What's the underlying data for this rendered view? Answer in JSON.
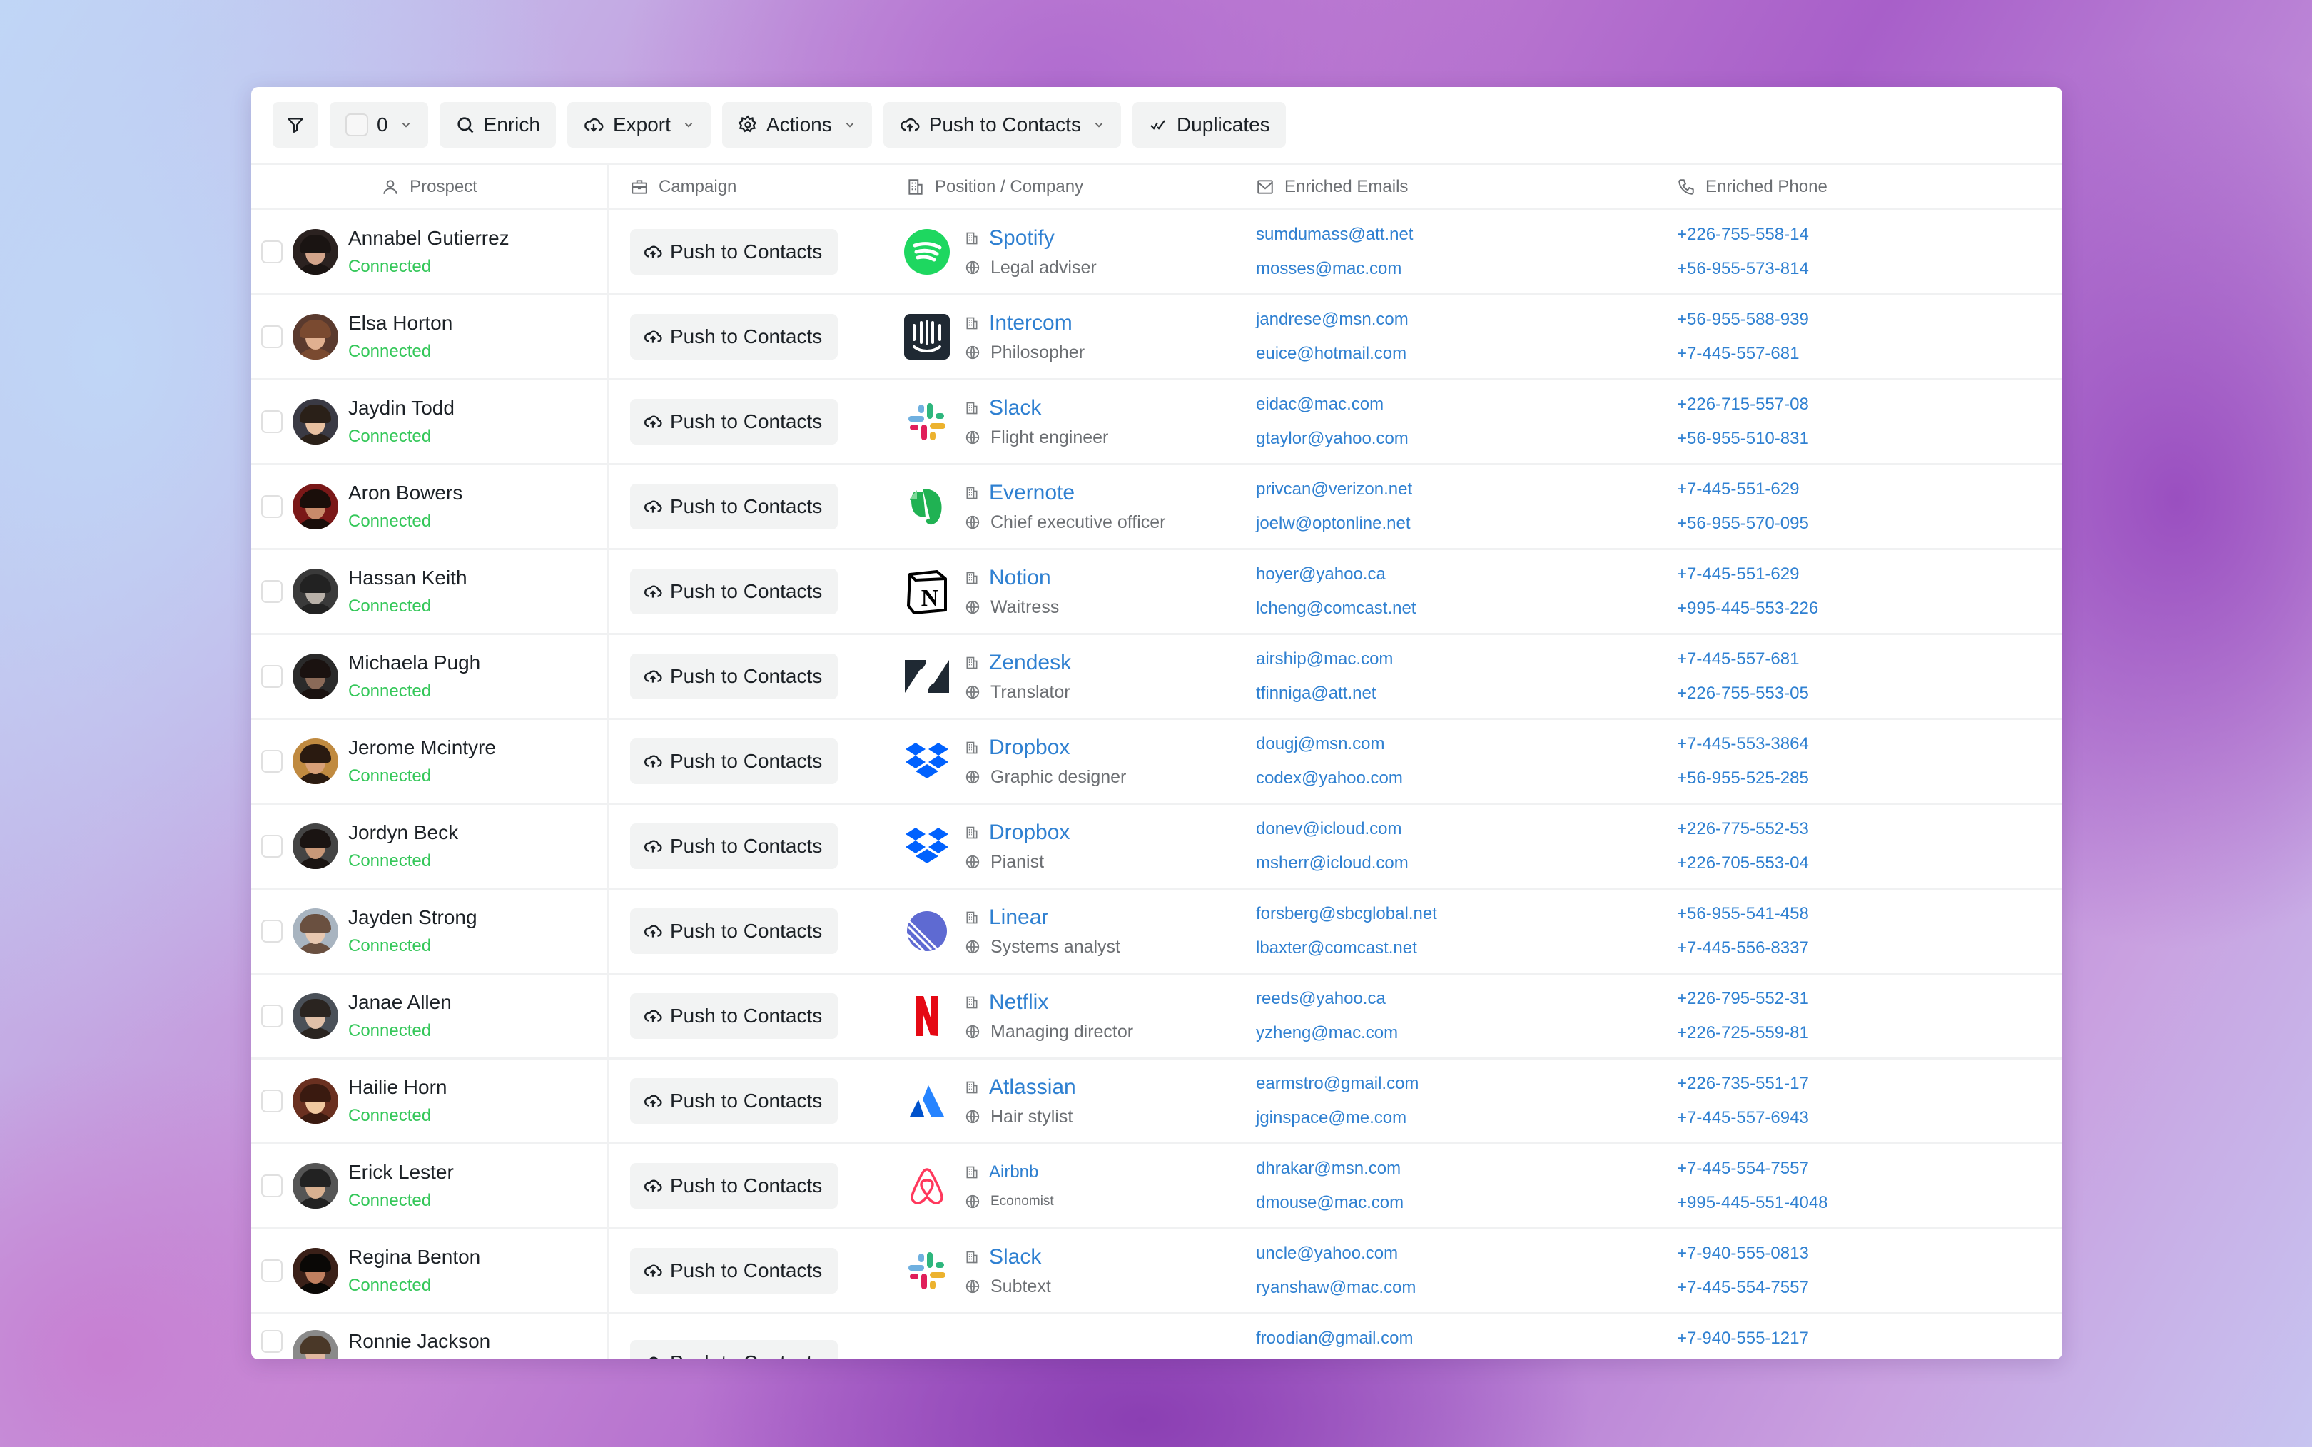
{
  "toolbar": {
    "filter_icon": "filter-icon",
    "selected_count": "0",
    "enrich_label": "Enrich",
    "export_label": "Export",
    "actions_label": "Actions",
    "push_label": "Push to Contacts",
    "duplicates_label": "Duplicates"
  },
  "columns": {
    "prospect": "Prospect",
    "campaign": "Campaign",
    "company": "Position / Company",
    "emails": "Enriched Emails",
    "phone": "Enriched Phone"
  },
  "colors": {
    "accent_link": "#2f80d1",
    "status_connected": "#34c759",
    "button_bg": "#f2f3f3"
  },
  "push_button_label": "Push to Contacts",
  "rows": [
    {
      "name": "Annabel Gutierrez",
      "status": "Connected",
      "company": "Spotify",
      "logo": "spotify",
      "position": "Legal adviser",
      "emails": [
        "sumdumass@att.net",
        "mosses@mac.com"
      ],
      "phones": [
        "+226-755-558-14",
        "+56-955-573-814"
      ]
    },
    {
      "name": "Elsa Horton",
      "status": "Connected",
      "company": "Intercom",
      "logo": "intercom",
      "position": "Philosopher",
      "emails": [
        "jandrese@msn.com",
        "euice@hotmail.com"
      ],
      "phones": [
        "+56-955-588-939",
        "+7-445-557-681"
      ]
    },
    {
      "name": "Jaydin Todd",
      "status": "Connected",
      "company": "Slack",
      "logo": "slack",
      "position": "Flight engineer",
      "emails": [
        "eidac@mac.com",
        "gtaylor@yahoo.com"
      ],
      "phones": [
        "+226-715-557-08",
        "+56-955-510-831"
      ]
    },
    {
      "name": "Aron Bowers",
      "status": "Connected",
      "company": "Evernote",
      "logo": "evernote",
      "position": "Chief executive officer",
      "emails": [
        "privcan@verizon.net",
        "joelw@optonline.net"
      ],
      "phones": [
        "+7-445-551-629",
        "+56-955-570-095"
      ]
    },
    {
      "name": "Hassan Keith",
      "status": "Connected",
      "company": "Notion",
      "logo": "notion",
      "position": "Waitress",
      "emails": [
        "hoyer@yahoo.ca",
        "lcheng@comcast.net"
      ],
      "phones": [
        "+7-445-551-629",
        "+995-445-553-226"
      ]
    },
    {
      "name": "Michaela Pugh",
      "status": "Connected",
      "company": "Zendesk",
      "logo": "zendesk",
      "position": "Translator",
      "emails": [
        "airship@mac.com",
        "tfinniga@att.net"
      ],
      "phones": [
        "+7-445-557-681",
        "+226-755-553-05"
      ]
    },
    {
      "name": "Jerome Mcintyre",
      "status": "Connected",
      "company": "Dropbox",
      "logo": "dropbox",
      "position": "Graphic designer",
      "emails": [
        "dougj@msn.com",
        "codex@yahoo.com"
      ],
      "phones": [
        "+7-445-553-3864",
        "+56-955-525-285"
      ]
    },
    {
      "name": "Jordyn Beck",
      "status": "Connected",
      "company": "Dropbox",
      "logo": "dropbox",
      "position": "Pianist",
      "emails": [
        "donev@icloud.com",
        "msherr@icloud.com"
      ],
      "phones": [
        "+226-775-552-53",
        "+226-705-553-04"
      ]
    },
    {
      "name": "Jayden Strong",
      "status": "Connected",
      "company": "Linear",
      "logo": "linear",
      "position": "Systems analyst",
      "emails": [
        "forsberg@sbcglobal.net",
        "lbaxter@comcast.net"
      ],
      "phones": [
        "+56-955-541-458",
        "+7-445-556-8337"
      ]
    },
    {
      "name": "Janae Allen",
      "status": "Connected",
      "company": "Netflix",
      "logo": "netflix",
      "position": "Managing director",
      "emails": [
        "reeds@yahoo.ca",
        "yzheng@mac.com"
      ],
      "phones": [
        "+226-795-552-31",
        "+226-725-559-81"
      ]
    },
    {
      "name": "Hailie Horn",
      "status": "Connected",
      "company": "Atlassian",
      "logo": "atlassian",
      "position": "Hair stylist",
      "emails": [
        "earmstro@gmail.com",
        "jginspace@me.com"
      ],
      "phones": [
        "+226-735-551-17",
        "+7-445-557-6943"
      ]
    },
    {
      "name": "Erick Lester",
      "status": "Connected",
      "company": "Airbnb",
      "logo": "airbnb",
      "position": "Economist",
      "emails": [
        "dhrakar@msn.com",
        "dmouse@mac.com"
      ],
      "phones": [
        "+7-445-554-7557",
        "+995-445-551-4048"
      ]
    },
    {
      "name": "Regina Benton",
      "status": "Connected",
      "company": "Slack",
      "logo": "slack",
      "position": "Subtext",
      "emails": [
        "uncle@yahoo.com",
        "ryanshaw@mac.com"
      ],
      "phones": [
        "+7-940-555-0813",
        "+7-445-554-7557"
      ]
    },
    {
      "name": "Ronnie Jackson",
      "status": "",
      "company": "",
      "logo": "",
      "position": "",
      "emails": [
        "froodian@gmail.com"
      ],
      "phones": [
        "+7-940-555-1217"
      ]
    }
  ]
}
